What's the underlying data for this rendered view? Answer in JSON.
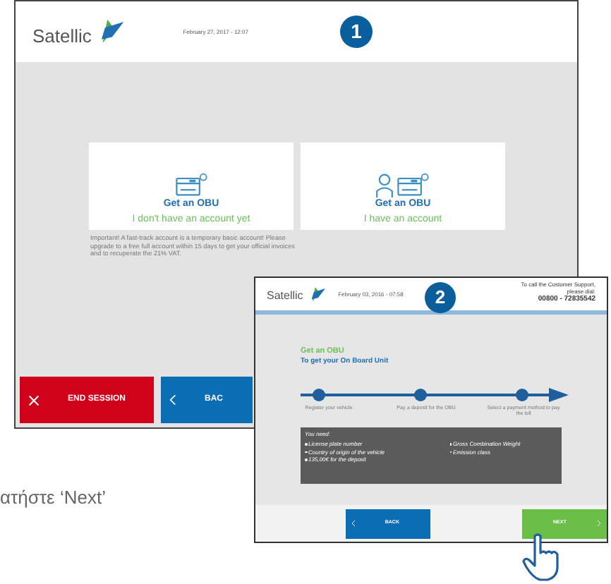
{
  "screen_1": {
    "badge": "1",
    "logo": "Satellic",
    "date": "February 27, 2017 - 12:07",
    "cards": [
      {
        "kind": "device",
        "title": "Get an OBU",
        "subtitle": "I don't have an account yet"
      },
      {
        "kind": "person-device",
        "title": "Get an OBU",
        "subtitle": "I have an account"
      }
    ],
    "notice": "Important! A fast-track account is a temporary basic account! Please upgrade to a free full account within 15 days to get your official invoices and to recuperate the 21% VAT.",
    "buttons": [
      {
        "kind": "end",
        "label": "END SESSION"
      },
      {
        "kind": "back",
        "label": "BAC"
      }
    ]
  },
  "screen_2": {
    "badge": "2",
    "logo": "Satellic",
    "date": "February 03, 2016 - 07:58",
    "support_note": "To call the Customer Support, please dial:",
    "support_number": "00800 - 72835542",
    "title": "Get an OBU",
    "subtitle": "To get your On Board Unit",
    "steps": [
      "Register your vehicle",
      "Pay a deposit for the OBU",
      "Select a payment method to pay the toll"
    ],
    "info": {
      "title": "You need:",
      "items": [
        "License plate number",
        "Country of origin of the vehicle",
        "135,00€ for the deposit",
        "Gross Combination Weight",
        "Emission class"
      ]
    },
    "buttons": [
      {
        "kind": "back",
        "label": "BACK"
      },
      {
        "kind": "next",
        "label": "NEXT"
      }
    ]
  },
  "caption": "ατήστε ‘Next’"
}
